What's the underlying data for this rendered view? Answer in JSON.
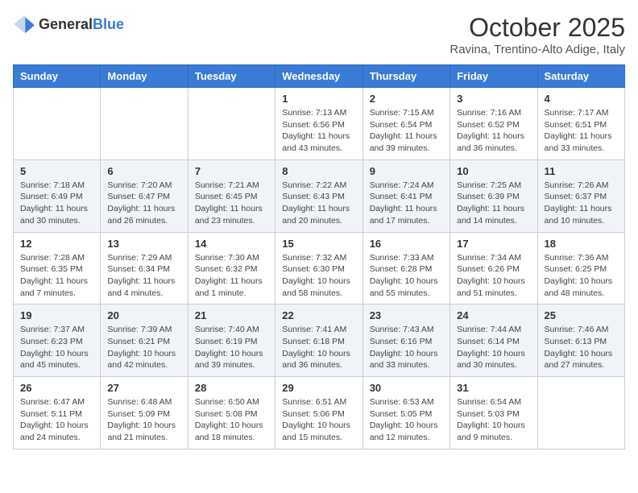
{
  "header": {
    "logo_general": "General",
    "logo_blue": "Blue",
    "month_title": "October 2025",
    "location": "Ravina, Trentino-Alto Adige, Italy"
  },
  "calendar": {
    "days_of_week": [
      "Sunday",
      "Monday",
      "Tuesday",
      "Wednesday",
      "Thursday",
      "Friday",
      "Saturday"
    ],
    "weeks": [
      [
        {
          "day": "",
          "info": ""
        },
        {
          "day": "",
          "info": ""
        },
        {
          "day": "",
          "info": ""
        },
        {
          "day": "1",
          "info": "Sunrise: 7:13 AM\nSunset: 6:56 PM\nDaylight: 11 hours and 43 minutes."
        },
        {
          "day": "2",
          "info": "Sunrise: 7:15 AM\nSunset: 6:54 PM\nDaylight: 11 hours and 39 minutes."
        },
        {
          "day": "3",
          "info": "Sunrise: 7:16 AM\nSunset: 6:52 PM\nDaylight: 11 hours and 36 minutes."
        },
        {
          "day": "4",
          "info": "Sunrise: 7:17 AM\nSunset: 6:51 PM\nDaylight: 11 hours and 33 minutes."
        }
      ],
      [
        {
          "day": "5",
          "info": "Sunrise: 7:18 AM\nSunset: 6:49 PM\nDaylight: 11 hours and 30 minutes."
        },
        {
          "day": "6",
          "info": "Sunrise: 7:20 AM\nSunset: 6:47 PM\nDaylight: 11 hours and 26 minutes."
        },
        {
          "day": "7",
          "info": "Sunrise: 7:21 AM\nSunset: 6:45 PM\nDaylight: 11 hours and 23 minutes."
        },
        {
          "day": "8",
          "info": "Sunrise: 7:22 AM\nSunset: 6:43 PM\nDaylight: 11 hours and 20 minutes."
        },
        {
          "day": "9",
          "info": "Sunrise: 7:24 AM\nSunset: 6:41 PM\nDaylight: 11 hours and 17 minutes."
        },
        {
          "day": "10",
          "info": "Sunrise: 7:25 AM\nSunset: 6:39 PM\nDaylight: 11 hours and 14 minutes."
        },
        {
          "day": "11",
          "info": "Sunrise: 7:26 AM\nSunset: 6:37 PM\nDaylight: 11 hours and 10 minutes."
        }
      ],
      [
        {
          "day": "12",
          "info": "Sunrise: 7:28 AM\nSunset: 6:35 PM\nDaylight: 11 hours and 7 minutes."
        },
        {
          "day": "13",
          "info": "Sunrise: 7:29 AM\nSunset: 6:34 PM\nDaylight: 11 hours and 4 minutes."
        },
        {
          "day": "14",
          "info": "Sunrise: 7:30 AM\nSunset: 6:32 PM\nDaylight: 11 hours and 1 minute."
        },
        {
          "day": "15",
          "info": "Sunrise: 7:32 AM\nSunset: 6:30 PM\nDaylight: 10 hours and 58 minutes."
        },
        {
          "day": "16",
          "info": "Sunrise: 7:33 AM\nSunset: 6:28 PM\nDaylight: 10 hours and 55 minutes."
        },
        {
          "day": "17",
          "info": "Sunrise: 7:34 AM\nSunset: 6:26 PM\nDaylight: 10 hours and 51 minutes."
        },
        {
          "day": "18",
          "info": "Sunrise: 7:36 AM\nSunset: 6:25 PM\nDaylight: 10 hours and 48 minutes."
        }
      ],
      [
        {
          "day": "19",
          "info": "Sunrise: 7:37 AM\nSunset: 6:23 PM\nDaylight: 10 hours and 45 minutes."
        },
        {
          "day": "20",
          "info": "Sunrise: 7:39 AM\nSunset: 6:21 PM\nDaylight: 10 hours and 42 minutes."
        },
        {
          "day": "21",
          "info": "Sunrise: 7:40 AM\nSunset: 6:19 PM\nDaylight: 10 hours and 39 minutes."
        },
        {
          "day": "22",
          "info": "Sunrise: 7:41 AM\nSunset: 6:18 PM\nDaylight: 10 hours and 36 minutes."
        },
        {
          "day": "23",
          "info": "Sunrise: 7:43 AM\nSunset: 6:16 PM\nDaylight: 10 hours and 33 minutes."
        },
        {
          "day": "24",
          "info": "Sunrise: 7:44 AM\nSunset: 6:14 PM\nDaylight: 10 hours and 30 minutes."
        },
        {
          "day": "25",
          "info": "Sunrise: 7:46 AM\nSunset: 6:13 PM\nDaylight: 10 hours and 27 minutes."
        }
      ],
      [
        {
          "day": "26",
          "info": "Sunrise: 6:47 AM\nSunset: 5:11 PM\nDaylight: 10 hours and 24 minutes."
        },
        {
          "day": "27",
          "info": "Sunrise: 6:48 AM\nSunset: 5:09 PM\nDaylight: 10 hours and 21 minutes."
        },
        {
          "day": "28",
          "info": "Sunrise: 6:50 AM\nSunset: 5:08 PM\nDaylight: 10 hours and 18 minutes."
        },
        {
          "day": "29",
          "info": "Sunrise: 6:51 AM\nSunset: 5:06 PM\nDaylight: 10 hours and 15 minutes."
        },
        {
          "day": "30",
          "info": "Sunrise: 6:53 AM\nSunset: 5:05 PM\nDaylight: 10 hours and 12 minutes."
        },
        {
          "day": "31",
          "info": "Sunrise: 6:54 AM\nSunset: 5:03 PM\nDaylight: 10 hours and 9 minutes."
        },
        {
          "day": "",
          "info": ""
        }
      ]
    ]
  }
}
